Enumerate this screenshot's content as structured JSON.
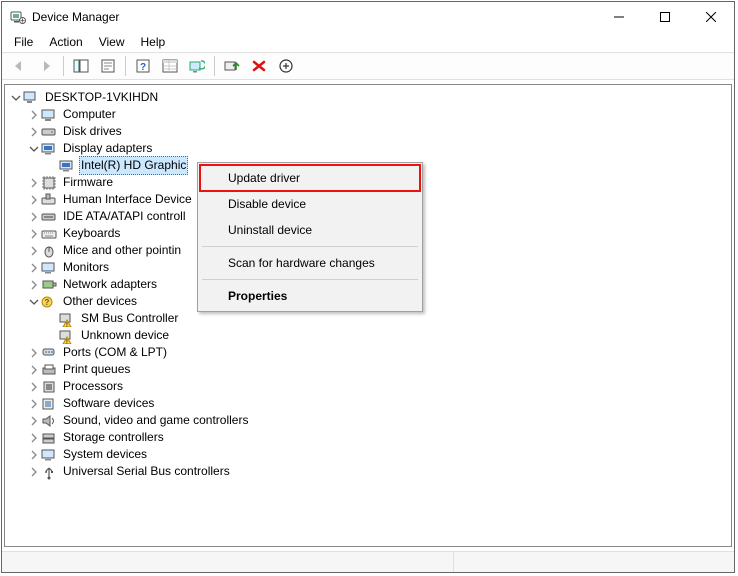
{
  "window": {
    "title": "Device Manager"
  },
  "menubar": {
    "file": "File",
    "action": "Action",
    "view": "View",
    "help": "Help"
  },
  "toolbar": {
    "back": "Back",
    "forward": "Forward",
    "show_hide_tree": "Show/Hide Console Tree",
    "properties": "Properties",
    "help": "Help",
    "detail": "Detail View",
    "scan": "Scan for hardware changes",
    "update_driver": "Update Device Driver",
    "uninstall": "Uninstall Device",
    "add_legacy": "Add legacy hardware"
  },
  "tree": {
    "root": "DESKTOP-1VKIHDN",
    "computer": "Computer",
    "disk_drives": "Disk drives",
    "display_adapters": "Display adapters",
    "display_child": "Intel(R) HD Graphic",
    "firmware": "Firmware",
    "hid": "Human Interface Device",
    "ide": "IDE ATA/ATAPI controll",
    "keyboards": "Keyboards",
    "mice": "Mice and other pointin",
    "monitors": "Monitors",
    "network": "Network adapters",
    "other": "Other devices",
    "other_sm": "SM Bus Controller",
    "other_unknown": "Unknown device",
    "ports": "Ports (COM & LPT)",
    "print_queues": "Print queues",
    "processors": "Processors",
    "software_devices": "Software devices",
    "sound": "Sound, video and game controllers",
    "storage": "Storage controllers",
    "system": "System devices",
    "usb": "Universal Serial Bus controllers"
  },
  "context_menu": {
    "update_driver": "Update driver",
    "disable_device": "Disable device",
    "uninstall_device": "Uninstall device",
    "scan": "Scan for hardware changes",
    "properties": "Properties"
  }
}
